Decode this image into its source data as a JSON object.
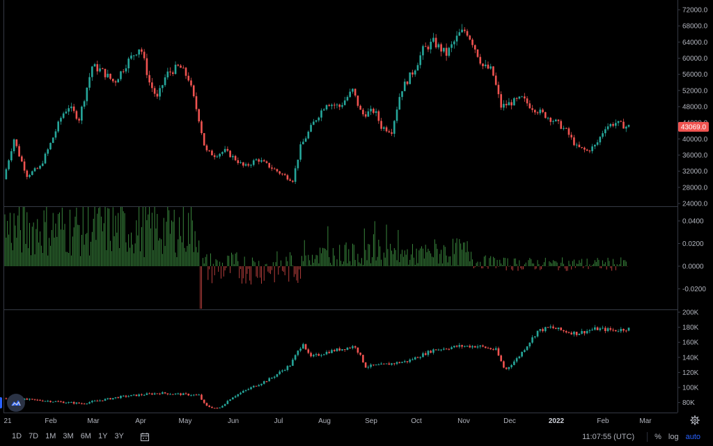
{
  "price_axis": {
    "ticks": [
      "72000.0",
      "68000.0",
      "64000.0",
      "60000.0",
      "56000.0",
      "52000.0",
      "48000.0",
      "44000.0",
      "40000.0",
      "36000.0",
      "32000.0",
      "28000.0",
      "24000.0"
    ],
    "last_price": "43069.0"
  },
  "indicator_axis": {
    "ticks": [
      "0.0400",
      "0.0200",
      "0.0000",
      "-0.0200"
    ]
  },
  "volume_axis": {
    "ticks": [
      "200K",
      "180K",
      "160K",
      "140K",
      "120K",
      "100K",
      "80K"
    ]
  },
  "time_axis": {
    "labels": [
      "21",
      "Feb",
      "Mar",
      "Apr",
      "May",
      "Jun",
      "Jul",
      "Aug",
      "Sep",
      "Oct",
      "Nov",
      "Dec",
      "2022",
      "Feb",
      "Mar"
    ],
    "bold_label": "2022"
  },
  "toolbar": {
    "timeframes": [
      "1D",
      "7D",
      "1M",
      "3M",
      "6M",
      "1Y",
      "3Y"
    ],
    "clock": "11:07:55 (UTC)",
    "percent_label": "%",
    "log_label": "log",
    "auto_label": "auto"
  },
  "colors": {
    "up": "#26a69a",
    "down": "#ef5350",
    "hist_up": "#4caf50",
    "hist_down": "#ef5350",
    "last_price_bg": "#ef5350",
    "accent": "#2962ff"
  },
  "icons": [
    "range-icon",
    "settings-icon",
    "tradingview-logo-icon"
  ],
  "chart_data": [
    {
      "type": "candlestick",
      "title": "",
      "x": [
        "Jan",
        "Feb",
        "Mar",
        "Apr",
        "May",
        "Jun",
        "Jul",
        "Aug",
        "Sep",
        "Oct",
        "Nov",
        "Dec",
        "2022 Jan",
        "Feb"
      ],
      "anchors": [
        [
          0,
          30000
        ],
        [
          8,
          40000
        ],
        [
          12,
          36000
        ],
        [
          18,
          31000
        ],
        [
          28,
          33000
        ],
        [
          35,
          38000
        ],
        [
          45,
          46000
        ],
        [
          50,
          48000
        ],
        [
          58,
          45000
        ],
        [
          68,
          58000
        ],
        [
          75,
          57000
        ],
        [
          85,
          54000
        ],
        [
          95,
          59000
        ],
        [
          105,
          63000
        ],
        [
          112,
          54000
        ],
        [
          118,
          50000
        ],
        [
          125,
          56000
        ],
        [
          135,
          58000
        ],
        [
          142,
          55000
        ],
        [
          150,
          45000
        ],
        [
          155,
          37000
        ],
        [
          162,
          36000
        ],
        [
          170,
          37000
        ],
        [
          178,
          35000
        ],
        [
          185,
          33000
        ],
        [
          195,
          35000
        ],
        [
          205,
          33000
        ],
        [
          215,
          31000
        ],
        [
          222,
          29800
        ],
        [
          228,
          38000
        ],
        [
          238,
          44000
        ],
        [
          248,
          49000
        ],
        [
          258,
          48000
        ],
        [
          268,
          52000
        ],
        [
          275,
          46000
        ],
        [
          285,
          47000
        ],
        [
          290,
          43000
        ],
        [
          298,
          42000
        ],
        [
          305,
          52000
        ],
        [
          315,
          57000
        ],
        [
          322,
          62000
        ],
        [
          330,
          64000
        ],
        [
          340,
          61000
        ],
        [
          350,
          66000
        ],
        [
          355,
          67000
        ],
        [
          360,
          64000
        ],
        [
          368,
          58000
        ],
        [
          375,
          57000
        ],
        [
          382,
          48000
        ],
        [
          390,
          49000
        ],
        [
          398,
          50000
        ],
        [
          405,
          48000
        ],
        [
          415,
          46000
        ],
        [
          425,
          44000
        ],
        [
          432,
          42000
        ],
        [
          440,
          38000
        ],
        [
          448,
          37000
        ],
        [
          455,
          38500
        ],
        [
          462,
          43000
        ],
        [
          470,
          44000
        ],
        [
          478,
          43069
        ]
      ],
      "ylim": [
        24000,
        72000
      ]
    },
    {
      "type": "bar",
      "title": "",
      "ylim": [
        -0.025,
        0.046
      ],
      "note_values": "histogram oscillating around 0.0000, positive most of Jan–May, negative late May–Jul, positive Aug–Jan"
    },
    {
      "type": "candlestick",
      "title": "",
      "anchors": [
        [
          0,
          86000
        ],
        [
          30,
          83000
        ],
        [
          60,
          79000
        ],
        [
          90,
          88000
        ],
        [
          120,
          93000
        ],
        [
          150,
          90000
        ],
        [
          155,
          76000
        ],
        [
          165,
          72000
        ],
        [
          175,
          87000
        ],
        [
          190,
          100000
        ],
        [
          205,
          112000
        ],
        [
          220,
          130000
        ],
        [
          230,
          160000
        ],
        [
          235,
          140000
        ],
        [
          250,
          148000
        ],
        [
          270,
          155000
        ],
        [
          278,
          128000
        ],
        [
          290,
          130000
        ],
        [
          310,
          135000
        ],
        [
          330,
          150000
        ],
        [
          350,
          155000
        ],
        [
          365,
          155000
        ],
        [
          378,
          150000
        ],
        [
          385,
          123000
        ],
        [
          395,
          140000
        ],
        [
          410,
          175000
        ],
        [
          420,
          180000
        ],
        [
          430,
          175000
        ],
        [
          440,
          172000
        ],
        [
          455,
          178000
        ],
        [
          470,
          176000
        ],
        [
          478,
          178000
        ]
      ],
      "ylim": [
        65000,
        200000
      ]
    }
  ]
}
